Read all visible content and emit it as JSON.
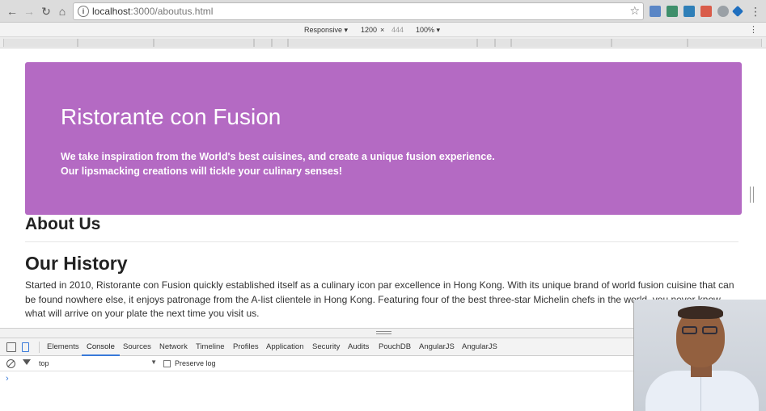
{
  "browser": {
    "url_host": "localhost",
    "url_path": ":3000/aboutus.html",
    "info_icon": "i"
  },
  "device_toolbar": {
    "mode": "Responsive",
    "width": "1200",
    "times": "×",
    "height": "444",
    "zoom": "100%"
  },
  "page": {
    "jumbotron": {
      "title": "Ristorante con Fusion",
      "line1": "We take inspiration from the World's best cuisines, and create a unique fusion experience.",
      "line2": "Our lipsmacking creations will tickle your culinary senses!"
    },
    "about_heading": "About Us",
    "history_heading": "Our History",
    "history_text": "Started in 2010, Ristorante con Fusion quickly established itself as a culinary icon par excellence in Hong Kong. With its unique brand of world fusion cuisine that can be found nowhere else, it enjoys patronage from the A-list clientele in Hong Kong. Featuring four of the best three-star Michelin chefs in the world, you never know what will arrive on your plate the next time you visit us."
  },
  "devtools": {
    "tabs": [
      "Elements",
      "Console",
      "Sources",
      "Network",
      "Timeline",
      "Profiles",
      "Application",
      "Security",
      "Audits",
      "PouchDB",
      "AngularJS",
      "AngularJS"
    ],
    "active_tab": "Console",
    "context": "top",
    "preserve_log": "Preserve log",
    "prompt": "›"
  },
  "colors": {
    "jumbotron": "#b46ac3",
    "active_tab_underline": "#3879d9"
  }
}
